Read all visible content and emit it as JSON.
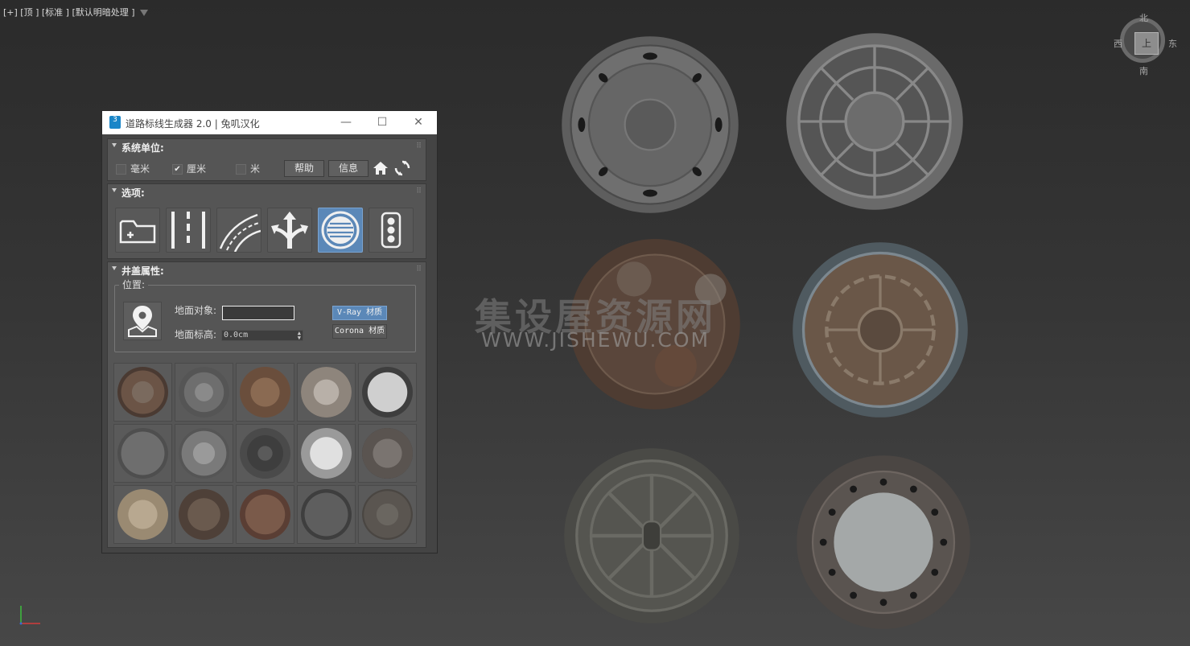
{
  "viewport": {
    "label": "[+] [顶 ] [标准 ] [默认明暗处理 ]",
    "viewcube": {
      "north": "北",
      "south": "南",
      "east": "东",
      "west": "西",
      "face": "上"
    }
  },
  "watermark": {
    "cn": "集设屋资源网",
    "en": "WWW.JISHEWU.COM"
  },
  "window": {
    "app_icon": "3",
    "title": "道路标线生成器 2.0 | 兔叽汉化",
    "minimize": "—",
    "maximize": "☐",
    "close": "✕"
  },
  "units": {
    "title": "系统单位:",
    "options": [
      {
        "label": "毫米",
        "checked": false
      },
      {
        "label": "厘米",
        "checked": true
      },
      {
        "label": "米",
        "checked": false
      }
    ],
    "help": "帮助",
    "info": "信息"
  },
  "options": {
    "title": "选项:",
    "buttons": [
      {
        "name": "new-folder-icon",
        "active": false
      },
      {
        "name": "lane-lines-icon",
        "active": false
      },
      {
        "name": "curved-lines-icon",
        "active": false
      },
      {
        "name": "split-arrow-icon",
        "active": false
      },
      {
        "name": "manhole-cover-icon",
        "active": true
      },
      {
        "name": "traffic-light-icon",
        "active": false
      }
    ]
  },
  "cover_props": {
    "title": "井盖属性:",
    "group_label": "位置:",
    "ground_object_label": "地面对象:",
    "ground_object_value": "",
    "ground_height_label": "地面标高:",
    "ground_height_value": "0.0cm",
    "vray_button": "V-Ray 材质",
    "corona_button": "Corona 材质"
  },
  "colors": {
    "accent": "#5b88b8",
    "panel": "#555555",
    "window_bg": "#444444"
  }
}
